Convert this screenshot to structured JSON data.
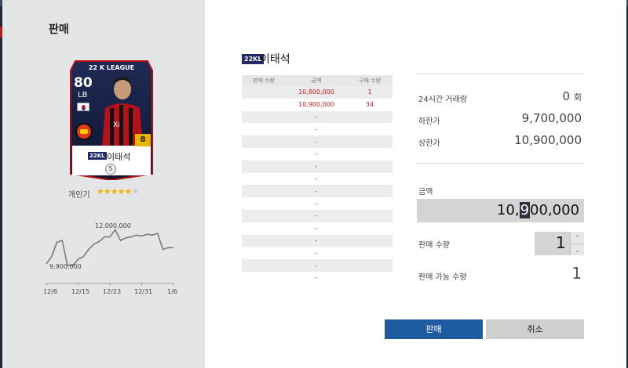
{
  "dialog": {
    "title": "판매"
  },
  "card": {
    "league": "22 K LEAGUE",
    "ovr": "80",
    "position": "LB",
    "boost": "8",
    "tag": "22KL",
    "name": "이태석",
    "grade": "5"
  },
  "popularity": {
    "label": "개인기",
    "stars": 5,
    "max": 6
  },
  "price_chart": {
    "max_label": "12,000,000",
    "min_label": "9,900,000",
    "x_labels": [
      "12/8",
      "12/15",
      "12/23",
      "12/31",
      "1/6"
    ]
  },
  "chart_data": {
    "type": "line",
    "x_ticks": [
      "12/8",
      "12/15",
      "12/23",
      "12/31",
      "1/6"
    ],
    "annotations": [
      "12,000,000",
      "9,900,000"
    ],
    "ylim": [
      9700000,
      12500000
    ],
    "series": [
      {
        "values": [
          10100000,
          10500000,
          11300000,
          11400000,
          10000000,
          10000000,
          10350000,
          10500000,
          10900000,
          11200000,
          11350000,
          11600000,
          11600000,
          12000000,
          11400000,
          11550000,
          11600000,
          11700000,
          11650000,
          11750000,
          11700000,
          11800000,
          10900000,
          11000000,
          11000000
        ]
      }
    ]
  },
  "player": {
    "tag": "22KL",
    "name": "이태석"
  },
  "orders": {
    "headers": [
      "판매 수량",
      "금액",
      "구매 수량"
    ],
    "rows": [
      {
        "sell": "",
        "price": "10,800,000",
        "buy": "1"
      },
      {
        "sell": "",
        "price": "10,900,000",
        "buy": "34"
      },
      {
        "sell": "",
        "price": "-",
        "buy": ""
      },
      {
        "sell": "",
        "price": "-",
        "buy": ""
      },
      {
        "sell": "",
        "price": "-",
        "buy": ""
      },
      {
        "sell": "",
        "price": "-",
        "buy": ""
      },
      {
        "sell": "",
        "price": "-",
        "buy": ""
      },
      {
        "sell": "",
        "price": "-",
        "buy": ""
      },
      {
        "sell": "",
        "price": "-",
        "buy": ""
      },
      {
        "sell": "",
        "price": "-",
        "buy": ""
      },
      {
        "sell": "",
        "price": "-",
        "buy": ""
      },
      {
        "sell": "",
        "price": "-",
        "buy": ""
      },
      {
        "sell": "",
        "price": "-",
        "buy": ""
      },
      {
        "sell": "",
        "price": "-",
        "buy": ""
      },
      {
        "sell": "",
        "price": "-",
        "buy": ""
      },
      {
        "sell": "",
        "price": "-",
        "buy": ""
      }
    ]
  },
  "stats": {
    "volume_label": "24시간 거래량",
    "volume_value": "0",
    "volume_unit": "회",
    "low_label": "하한가",
    "low_value": "9,700,000",
    "high_label": "상한가",
    "high_value": "10,900,000"
  },
  "amount": {
    "label": "금액",
    "pre": "10,",
    "hl": "9",
    "post": "00,000"
  },
  "quantity": {
    "label": "판매 수량",
    "value": "1",
    "up": "⌃",
    "down": "⌄"
  },
  "available": {
    "label": "판매 가능 수량",
    "value": "1"
  },
  "buttons": {
    "sell": "판매",
    "cancel": "취소"
  }
}
